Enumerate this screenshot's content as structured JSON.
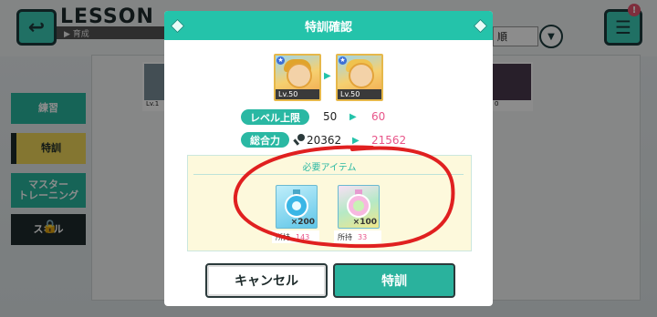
{
  "header": {
    "title": "LESSON",
    "subtitle": "育成",
    "sort_label": "順",
    "notification_count": "!"
  },
  "sidebar": {
    "items": [
      {
        "label": "練習"
      },
      {
        "label": "特訓"
      },
      {
        "label": "マスター\nトレーニング"
      },
      {
        "label": "スキル"
      }
    ]
  },
  "background_cards": [
    {
      "level": "Lv.1"
    },
    {
      "level": "0"
    }
  ],
  "dialog": {
    "title": "特訓確認",
    "card_before": {
      "level": "Lv.50"
    },
    "card_after": {
      "level": "Lv.50"
    },
    "stats": [
      {
        "label": "レベル上限",
        "old": "50",
        "new": "60"
      },
      {
        "label": "総合力",
        "old": "20362",
        "new": "21562"
      }
    ],
    "items_section": {
      "title": "必要アイテム",
      "items": [
        {
          "icon": "blue-crystal-bottle-icon",
          "quantity": "×200",
          "owned_label": "所持",
          "owned": "143"
        },
        {
          "icon": "rainbow-crystal-bottle-icon",
          "quantity": "×100",
          "owned_label": "所持",
          "owned": "33"
        }
      ]
    },
    "cancel_label": "キャンセル",
    "confirm_label": "特訓"
  },
  "colors": {
    "accent": "#24c3aa",
    "highlight": "#e8568a",
    "annotation": "#e02020"
  }
}
